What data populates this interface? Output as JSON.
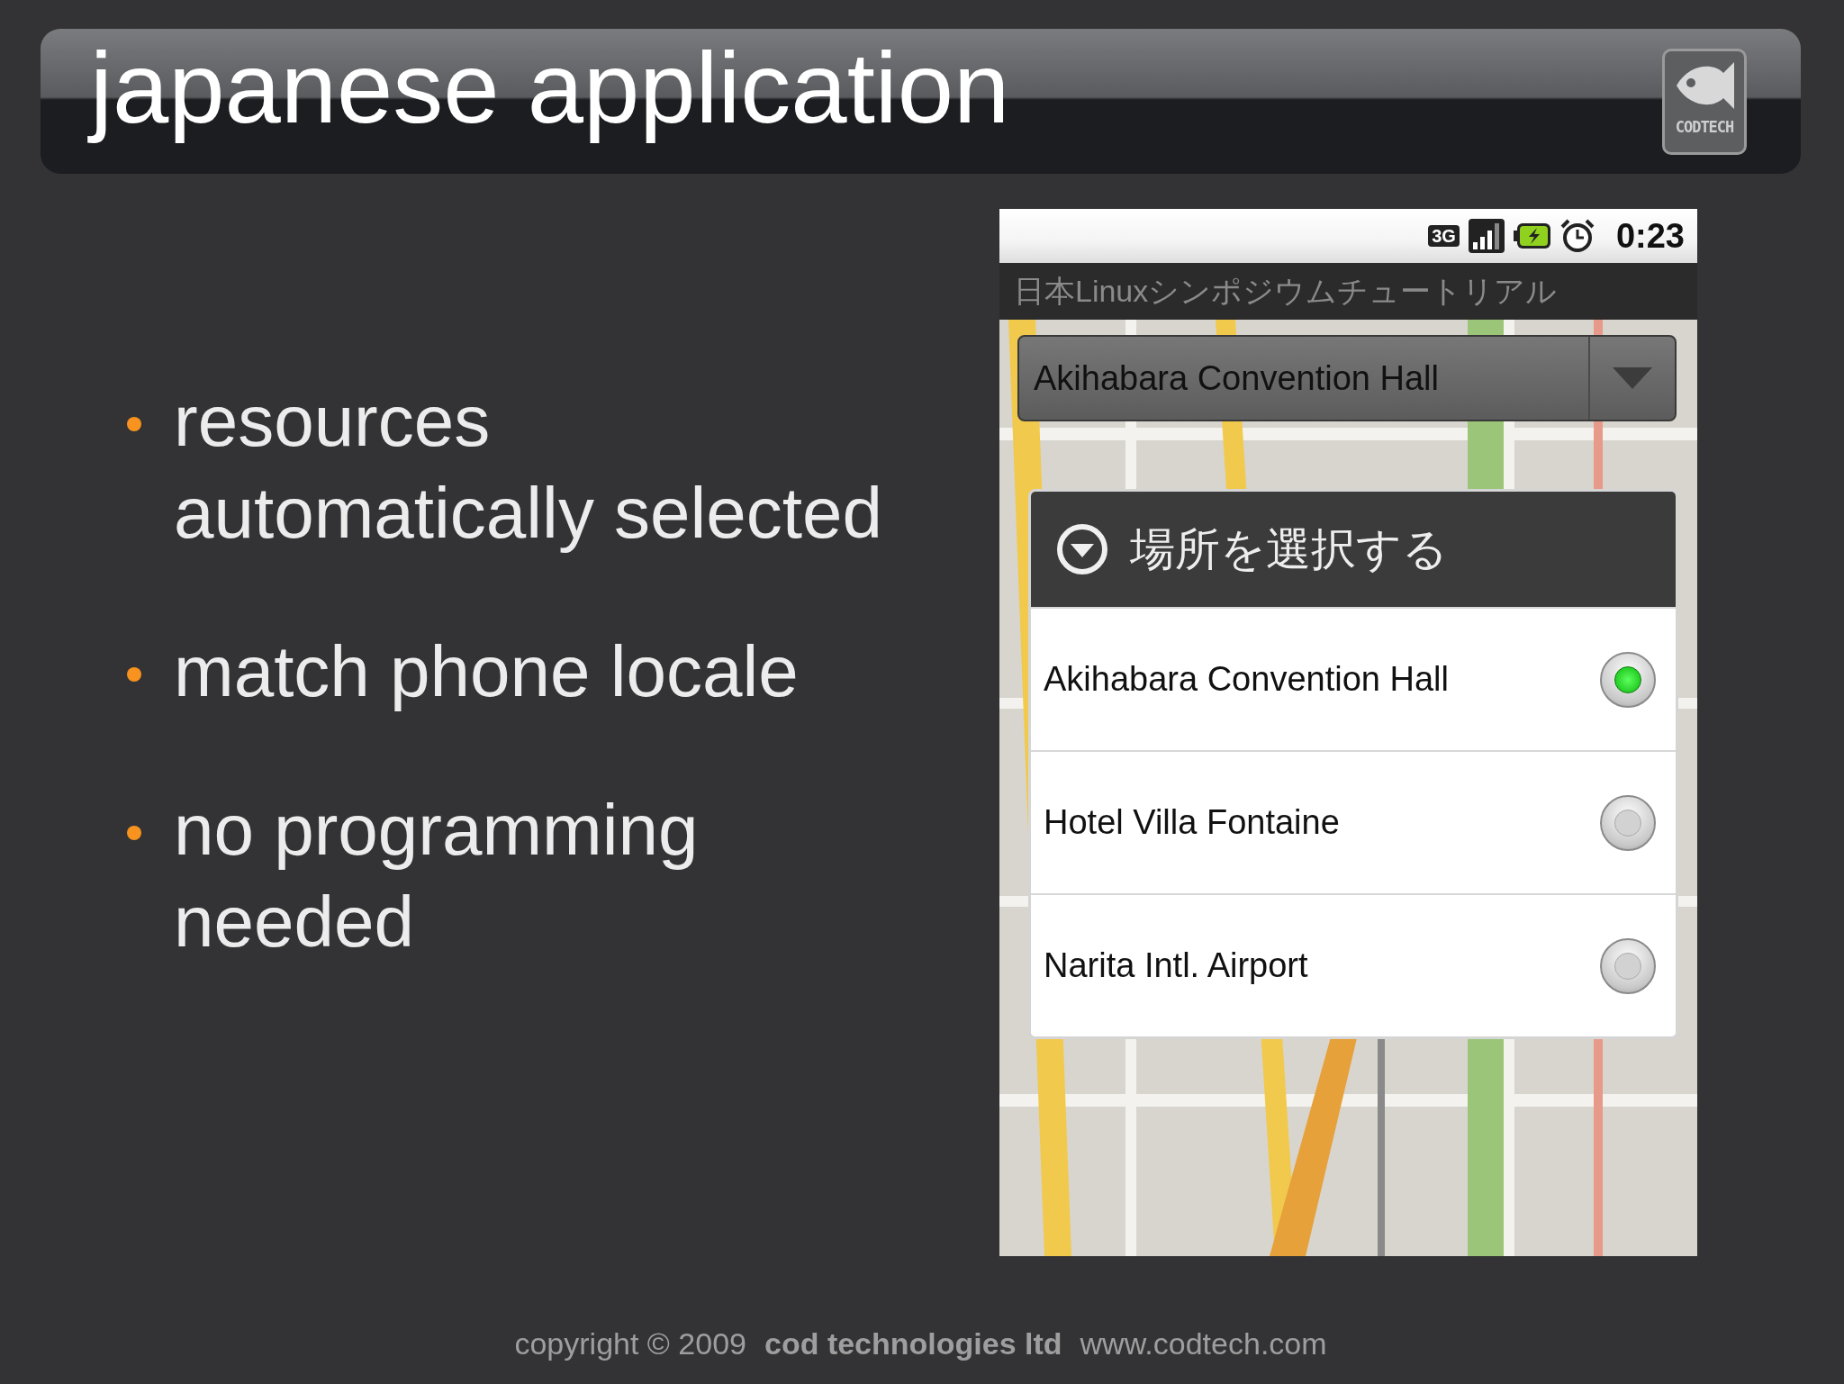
{
  "slide": {
    "title": "japanese application",
    "logo_text": "CODTECH"
  },
  "bullets": [
    {
      "lines": [
        "resources",
        "automatically selected"
      ]
    },
    {
      "lines": [
        "match phone locale"
      ]
    },
    {
      "lines": [
        "no programming",
        "needed"
      ]
    }
  ],
  "phone": {
    "status_bar": {
      "network": "3G",
      "time": "0:23"
    },
    "app_title": "日本Linuxシンポジウムチュートリアル",
    "spinner": {
      "value": "Akihabara Convention Hall"
    },
    "dialog": {
      "title": "場所を選択する",
      "options": [
        {
          "label": "Akihabara Convention Hall",
          "selected": true
        },
        {
          "label": "Hotel Villa Fontaine",
          "selected": false
        },
        {
          "label": "Narita Intl. Airport",
          "selected": false
        }
      ]
    }
  },
  "footer": {
    "copyright": "copyright © 2009",
    "company": "cod technologies ltd",
    "url": "www.codtech.com"
  }
}
